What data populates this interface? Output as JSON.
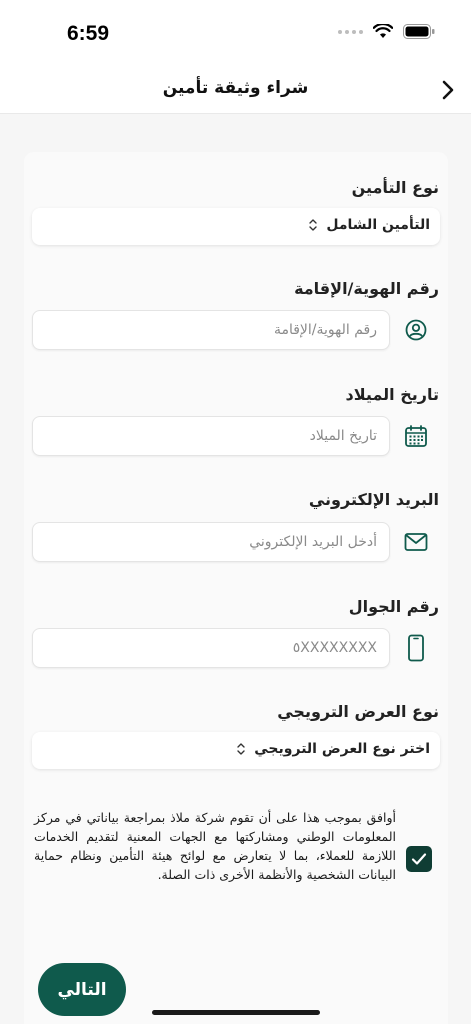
{
  "status_bar": {
    "time": "6:59"
  },
  "nav": {
    "title": "شراء وثيقة تأمين"
  },
  "form": {
    "insurance_type": {
      "label": "نوع التأمين",
      "value": "التأمين الشامل"
    },
    "id_number": {
      "label": "رقم الهوية/الإقامة",
      "placeholder": "رقم الهوية/الإقامة"
    },
    "birth_date": {
      "label": "تاريخ الميلاد",
      "placeholder": "تاريخ الميلاد"
    },
    "email": {
      "label": "البريد الإلكتروني",
      "placeholder": "أدخل البريد الإلكتروني"
    },
    "mobile": {
      "label": "رقم الجوال",
      "placeholder": "٥XXXXXXXX"
    },
    "promo_type": {
      "label": "نوع العرض الترويجي",
      "value": "اختر نوع العرض الترويجي"
    }
  },
  "consent": {
    "checked": true,
    "text": "أوافق بموجب هذا على أن تقوم شركة ملاذ بمراجعة بياناتي في مركز المعلومات الوطني ومشاركتها مع الجهات المعنية لتقديم الخدمات اللازمة للعملاء، بما لا يتعارض مع لوائح هيئة التأمين ونظام حماية البيانات الشخصية والأنظمة الأخرى ذات الصلة."
  },
  "actions": {
    "next_label": "التالي"
  },
  "colors": {
    "primary": "#0f5a4c",
    "checkbox": "#0f3d34",
    "icon": "#0f5a4c"
  }
}
